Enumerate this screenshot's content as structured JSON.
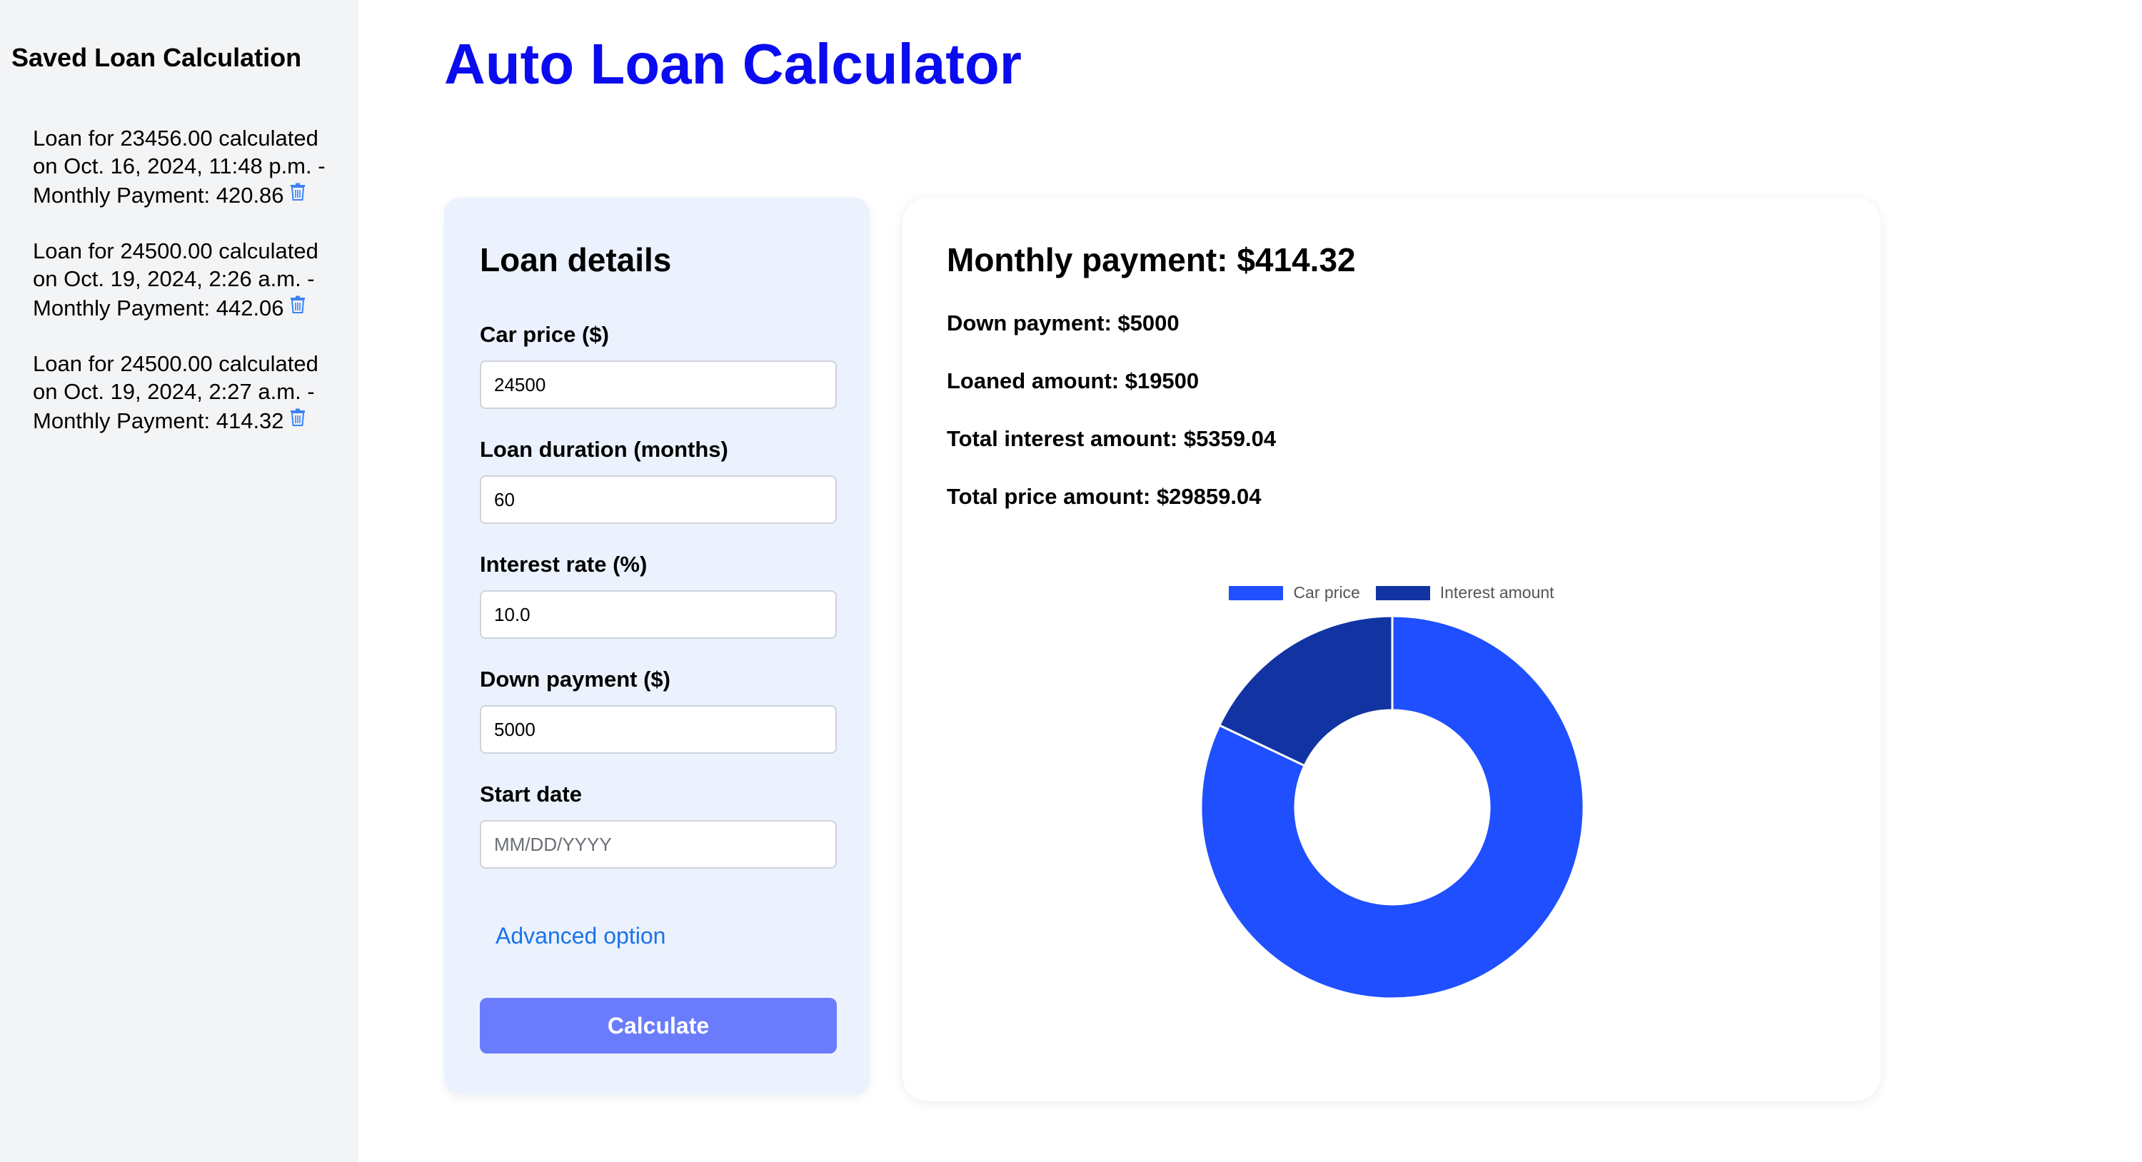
{
  "sidebar": {
    "title": "Saved Loan Calculation",
    "items": [
      {
        "text": "Loan for 23456.00 calculated on Oct. 16, 2024, 11:48 p.m. - Monthly Payment: 420.86"
      },
      {
        "text": "Loan for 24500.00 calculated on Oct. 19, 2024, 2:26 a.m. - Monthly Payment: 442.06"
      },
      {
        "text": "Loan for 24500.00 calculated on Oct. 19, 2024, 2:27 a.m. - Monthly Payment: 414.32"
      }
    ],
    "delete_icon": "trash-icon"
  },
  "header": {
    "title": "Auto Loan Calculator"
  },
  "form": {
    "heading": "Loan details",
    "car_price": {
      "label": "Car price ($)",
      "value": "24500"
    },
    "duration": {
      "label": "Loan duration (months)",
      "value": "60"
    },
    "interest_rate": {
      "label": "Interest rate (%)",
      "value": "10.0"
    },
    "down_payment": {
      "label": "Down payment ($)",
      "value": "5000"
    },
    "start_date": {
      "label": "Start date",
      "value": "",
      "placeholder": "MM/DD/YYYY"
    },
    "advanced_label": "Advanced option",
    "calculate_label": "Calculate"
  },
  "results": {
    "monthly_payment": "Monthly payment: $414.32",
    "down_payment": "Down payment: $5000",
    "loaned_amount": "Loaned amount: $19500",
    "total_interest": "Total interest amount: $5359.04",
    "total_price": "Total price amount: $29859.04"
  },
  "colors": {
    "accent_title": "#0b0bef",
    "car_price": "#1f4ffe",
    "interest_amount": "#1234a3",
    "button": "#6a7cfc",
    "link": "#1a73e8"
  },
  "chart_data": {
    "type": "pie",
    "variant": "donut",
    "legend_position": "top",
    "series": [
      {
        "name": "Car price",
        "value": 24500
      },
      {
        "name": "Interest amount",
        "value": 5359.04
      }
    ]
  }
}
